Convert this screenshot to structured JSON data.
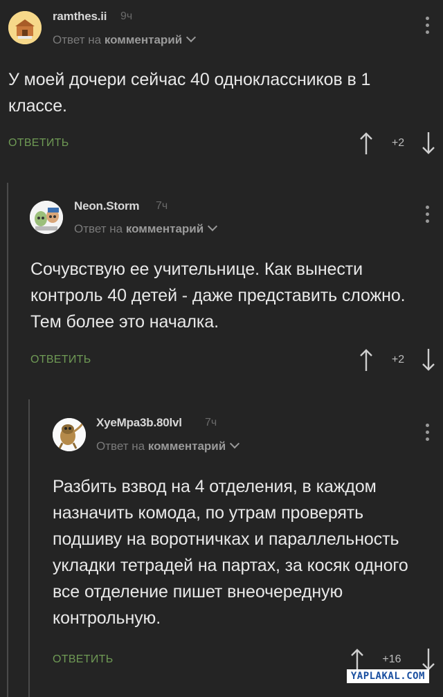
{
  "comments": [
    {
      "username": "ramthes.ii",
      "time": "9ч",
      "reply_prefix": "Ответ на",
      "reply_target": "комментарий",
      "text": "У моей дочери сейчас 40 одноклассников в 1 классе.",
      "reply_label": "ОТВЕТИТЬ",
      "score": "+2"
    },
    {
      "username": "Neon.Storm",
      "time": "7ч",
      "reply_prefix": "Ответ на",
      "reply_target": "комментарий",
      "text": "Сочувствую ее учительнице. Как вынести контроль 40 детей - даже представить сложно. Тем более это началка.",
      "reply_label": "ОТВЕТИТЬ",
      "score": "+2"
    },
    {
      "username": "XyeMpa3b.80lvl",
      "time": "7ч",
      "reply_prefix": "Ответ на",
      "reply_target": "комментарий",
      "text": "Разбить взвод на 4 отделения, в каждом назначить комода, по утрам проверять подшиву на воротничках и параллельность укладки тетрадей на партах, за косяк одного все отделение пишет внеочередную контрольную.",
      "reply_label": "ОТВЕТИТЬ",
      "score": "+16"
    }
  ],
  "watermark": "YAPLAKAL.COM",
  "colors": {
    "background": "#242424",
    "reply_button": "#6f9a55",
    "thread_line": "#4a4a4a"
  },
  "icons": [
    "chevron-down-icon",
    "more-vert-icon",
    "arrow-up-icon",
    "arrow-down-icon"
  ]
}
